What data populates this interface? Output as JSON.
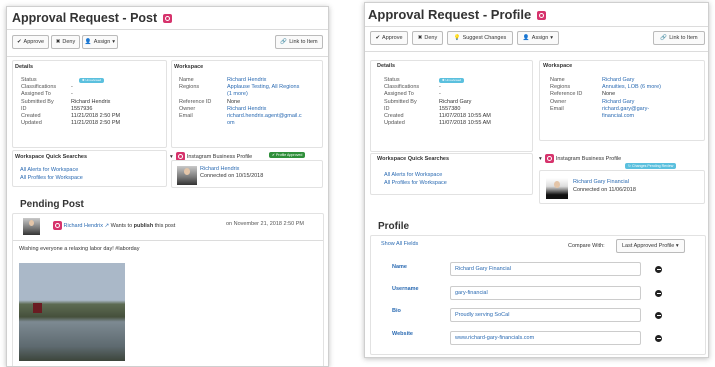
{
  "left": {
    "title": "Approval Request - Post",
    "toolbar": {
      "approve": "Approve",
      "deny": "Deny",
      "assign": "Assign",
      "link": "Link to Item"
    },
    "details": {
      "heading": "Details",
      "rows": [
        {
          "k": "Status",
          "v": ""
        },
        {
          "k": "Classifications",
          "v": "-"
        },
        {
          "k": "Assigned To",
          "v": "-"
        },
        {
          "k": "Submitted By",
          "v": "Richard Hendrix"
        },
        {
          "k": "ID",
          "v": "1557936"
        },
        {
          "k": "Created",
          "v": "11/21/2018 2:50 PM"
        },
        {
          "k": "Updated",
          "v": "11/21/2018 2:50 PM"
        }
      ],
      "status_badge": "Unreviewed"
    },
    "workspace": {
      "heading": "Workspace",
      "rows": [
        {
          "k": "Name",
          "v": "Richard Hendrix"
        },
        {
          "k": "Regions",
          "v": "Applause Testing, All Regions"
        },
        {
          "k": "",
          "v": "(1 more)"
        },
        {
          "k": "Reference ID",
          "v": "None"
        },
        {
          "k": "Owner",
          "v": "Richard Hendrix"
        },
        {
          "k": "Email",
          "v": "richard.hendrix.agent@gmail.c"
        },
        {
          "k": "",
          "v": "om"
        }
      ]
    },
    "quick_searches": {
      "heading": "Workspace Quick Searches",
      "alerts": "All Alerts for Workspace",
      "profiles": "All Profiles for Workspace"
    },
    "ig_profile": {
      "label": "Instagram Business Profile",
      "badge": "Profile Approved",
      "name": "Richard Hendrix",
      "connected": "Connected on 10/15/2018"
    },
    "pending": {
      "heading": "Pending Post",
      "author": "Richard Hendrix",
      "action_pre": "Wants to",
      "action_bold": "publish",
      "action_post": "this post",
      "date": "on November 21, 2018 2:50 PM",
      "body": "Wishing everyone a relaxing labor day! #laborday"
    }
  },
  "right": {
    "title": "Approval Request - Profile",
    "toolbar": {
      "approve": "Approve",
      "deny": "Deny",
      "suggest": "Suggest Changes",
      "assign": "Assign",
      "link": "Link to Item"
    },
    "details": {
      "heading": "Details",
      "rows": [
        {
          "k": "Status",
          "v": ""
        },
        {
          "k": "Classifications",
          "v": "-"
        },
        {
          "k": "Assigned To",
          "v": "-"
        },
        {
          "k": "Submitted By",
          "v": "Richard Gary"
        },
        {
          "k": "ID",
          "v": "1557380"
        },
        {
          "k": "Created",
          "v": "11/07/2018 10:55 AM"
        },
        {
          "k": "Updated",
          "v": "11/07/2018 10:55 AM"
        }
      ],
      "status_badge": "Unreviewed"
    },
    "workspace": {
      "heading": "Workspace",
      "rows": [
        {
          "k": "Name",
          "v": "Richard Gary"
        },
        {
          "k": "Regions",
          "v": "Annuities, LOB (6 more)"
        },
        {
          "k": "Reference ID",
          "v": "None"
        },
        {
          "k": "Owner",
          "v": "Richard Gary"
        },
        {
          "k": "Email",
          "v": "richard.gary@gary-"
        },
        {
          "k": "",
          "v": "financial.com"
        }
      ]
    },
    "quick_searches": {
      "heading": "Workspace Quick Searches",
      "alerts": "All Alerts for Workspace",
      "profiles": "All Profiles for Workspace"
    },
    "ig_profile": {
      "label": "Instagram Business Profile",
      "badge": "Changes Pending Review",
      "name": "Richard Gary Financial",
      "connected": "Connected on 11/06/2018"
    },
    "profile": {
      "heading": "Profile",
      "show_all": "Show All Fields",
      "compare_label": "Compare With:",
      "compare_value": "Last Approved Profile",
      "fields": [
        {
          "label": "Name",
          "value": "Richard Gary Financial"
        },
        {
          "label": "Username",
          "value": "gary-financial"
        },
        {
          "label": "Bio",
          "value": "Proudly serving SoCal"
        },
        {
          "label": "Website",
          "value": "www.richard-gary-financials.com"
        }
      ]
    }
  }
}
